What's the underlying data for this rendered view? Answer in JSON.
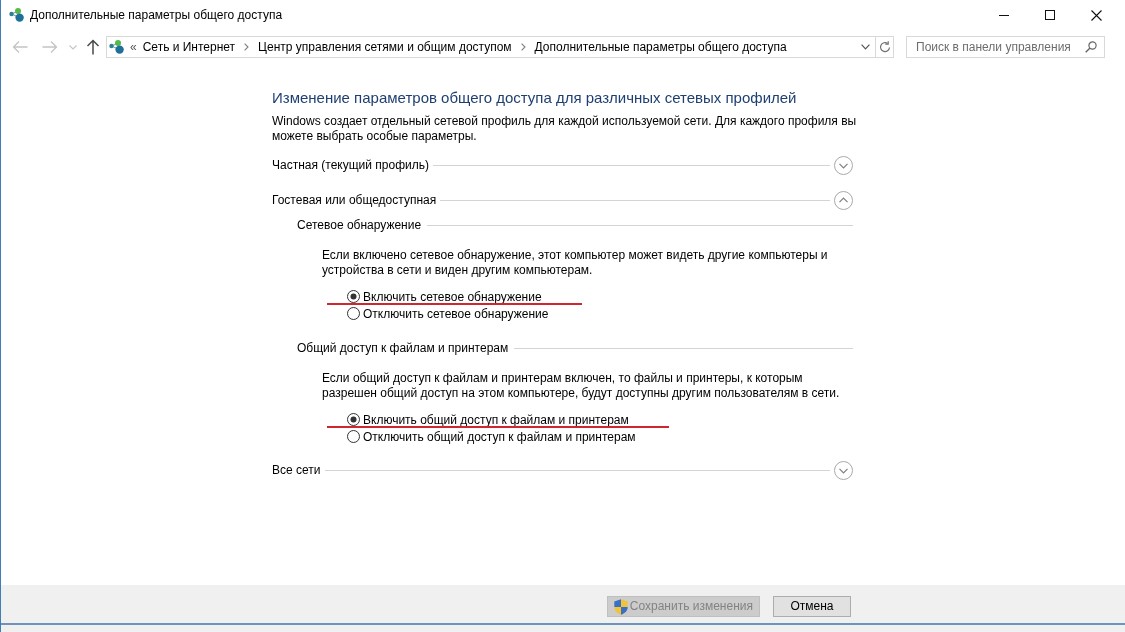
{
  "window": {
    "title": "Дополнительные параметры общего доступа"
  },
  "navigation": {
    "back_enabled": false,
    "forward_enabled": false,
    "history_enabled": false,
    "up_enabled": true
  },
  "address_bar": {
    "overflow": "«",
    "breadcrumbs": [
      "Сеть и Интернет",
      "Центр управления сетями и общим доступом",
      "Дополнительные параметры общего доступа"
    ]
  },
  "search": {
    "placeholder": "Поиск в панели управления"
  },
  "heading": "Изменение параметров общего доступа для различных сетевых профилей",
  "description": "Windows создает отдельный сетевой профиль для каждой используемой сети. Для каждого профиля вы можете выбрать особые параметры.",
  "profiles": [
    {
      "name": "Частная (текущий профиль)",
      "expanded": false
    },
    {
      "name": "Гостевая или общедоступная",
      "expanded": true,
      "sections": [
        {
          "title": "Сетевое обнаружение",
          "description": "Если включено сетевое обнаружение, этот компьютер может видеть другие компьютеры и устройства в сети и виден другим компьютерам.",
          "options": [
            {
              "label": "Включить сетевое обнаружение",
              "selected": true,
              "underlined": true
            },
            {
              "label": "Отключить сетевое обнаружение",
              "selected": false,
              "underlined": false
            }
          ]
        },
        {
          "title": "Общий доступ к файлам и принтерам",
          "description": "Если общий доступ к файлам и принтерам включен, то файлы и принтеры, к которым разрешен общий доступ на этом компьютере, будут доступны другим пользователям в сети.",
          "options": [
            {
              "label": "Включить общий доступ к файлам и принтерам",
              "selected": true,
              "underlined": true
            },
            {
              "label": "Отключить общий доступ к файлам и принтерам",
              "selected": false,
              "underlined": false
            }
          ]
        }
      ]
    },
    {
      "name": "Все сети",
      "expanded": false
    }
  ],
  "buttons": [
    {
      "label": "Сохранить изменения",
      "disabled": true,
      "shield": true
    },
    {
      "label": "Отмена",
      "disabled": false,
      "shield": false
    }
  ]
}
